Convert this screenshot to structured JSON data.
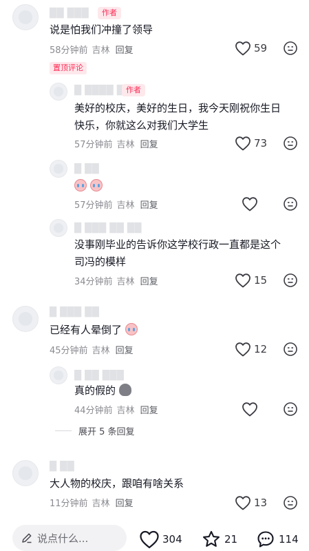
{
  "comments": [
    {
      "text": "说是怕我们冲撞了领导",
      "author_tag": "作者",
      "time": "58分钟前",
      "location": "吉林",
      "reply": "回复",
      "likes": "59"
    },
    {
      "pinned": "置顶评论",
      "author_tag": "作者",
      "text_lines": [
        "美好的校庆，美好的生日，我今天刚祝你生日",
        "快乐，你就这么对我们大学生"
      ],
      "time": "57分钟前",
      "location": "吉林",
      "reply": "回复",
      "likes": "73"
    },
    {
      "time": "57分钟前",
      "location": "吉林",
      "reply": "回复",
      "emoji": "crying-emoji"
    },
    {
      "text_lines": [
        "没事刚毕业的告诉你这学校行政一直都是这个",
        "司冯的模样"
      ],
      "time": "34分钟前",
      "location": "吉林",
      "reply": "回复",
      "likes": "15"
    },
    {
      "text": "已经有人晕倒了",
      "time": "45分钟前",
      "location": "吉林",
      "reply": "回复",
      "likes": "12"
    },
    {
      "text": "真的假的",
      "time": "44分钟前",
      "location": "吉林",
      "reply": "回复"
    },
    {
      "text": "大人物的校庆，跟咱有啥关系",
      "time": "11分钟前",
      "location": "吉林",
      "reply": "回复",
      "likes": "13"
    }
  ],
  "expand_replies": "展开 5 条回复",
  "bottom_bar": {
    "input_placeholder": "说点什么...",
    "likes": "304",
    "favorites": "21",
    "comments": "114"
  },
  "colors": {
    "accent": "#fe2c55",
    "meta": "#8a8b91"
  }
}
